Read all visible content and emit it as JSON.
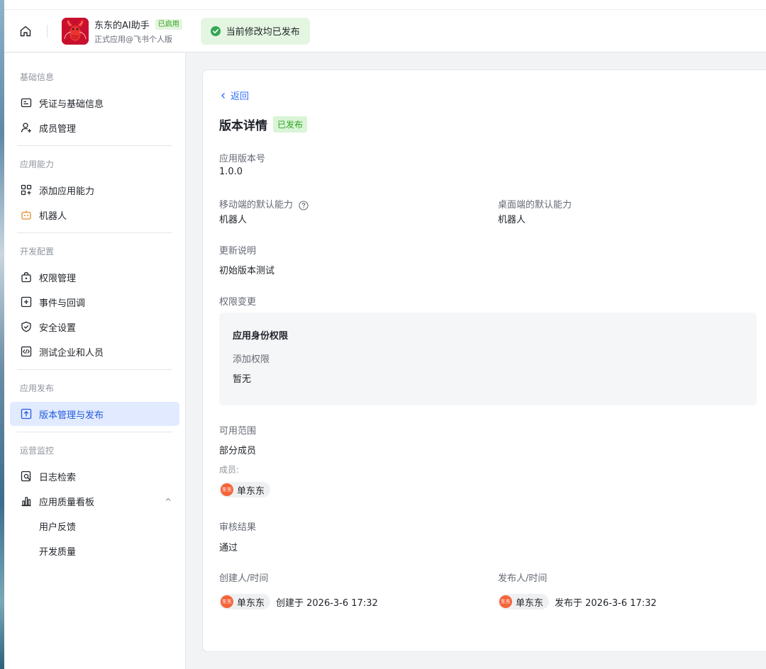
{
  "header": {
    "app_name": "东东的AI助手",
    "app_status": "已启用",
    "app_subtitle": "正式应用@飞书个人版",
    "publish_notice": "当前修改均已发布"
  },
  "sidebar": {
    "sections": {
      "basic": "基础信息",
      "capabilities": "应用能力",
      "dev_config": "开发配置",
      "release": "应用发布",
      "ops": "运营监控"
    },
    "items": {
      "credentials": "凭证与基础信息",
      "members": "成员管理",
      "add_capability": "添加应用能力",
      "bot": "机器人",
      "permissions": "权限管理",
      "events": "事件与回调",
      "security": "安全设置",
      "test_org": "测试企业和人员",
      "version": "版本管理与发布",
      "logs": "日志检索",
      "quality_board": "应用质量看板",
      "feedback": "用户反馈",
      "dev_quality": "开发质量"
    }
  },
  "detail": {
    "back": "返回",
    "title": "版本详情",
    "status": "已发布",
    "version_label": "应用版本号",
    "version_value": "1.0.0",
    "mobile_label": "移动端的默认能力",
    "mobile_value": "机器人",
    "desktop_label": "桌面端的默认能力",
    "desktop_value": "机器人",
    "notes_label": "更新说明",
    "notes_value": "初始版本测试",
    "perm_label": "权限变更",
    "perm_box_title": "应用身份权限",
    "perm_box_sub": "添加权限",
    "perm_box_value": "暂无",
    "scope_label": "可用范围",
    "scope_value": "部分成员",
    "members_label": "成员:",
    "member_name": "单东东",
    "avatar_text": "东东",
    "review_label": "审核结果",
    "review_value": "通过",
    "creator_label": "创建人/时间",
    "creator_name": "单东东",
    "created_text": "创建于 2026-3-6 17:32",
    "publisher_label": "发布人/时间",
    "publisher_name": "单东东",
    "published_text": "发布于 2026-3-6 17:32"
  },
  "colors": {
    "accent": "#3370ff",
    "active_bg": "#e1eaff",
    "success": "#2ea121",
    "avatar": "#f5643a"
  }
}
